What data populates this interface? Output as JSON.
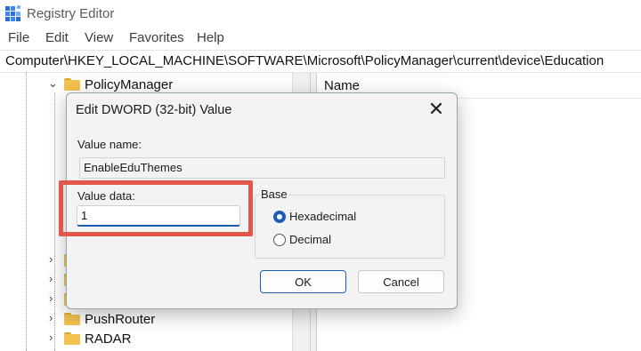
{
  "window": {
    "title": "Registry Editor"
  },
  "menu": {
    "items": [
      "File",
      "Edit",
      "View",
      "Favorites",
      "Help"
    ]
  },
  "address": {
    "path": "Computer\\HKEY_LOCAL_MACHINE\\SOFTWARE\\Microsoft\\PolicyManager\\current\\device\\Education"
  },
  "tree": {
    "expanded_item": "PolicyManager",
    "items": [
      "PushRouter",
      "RADAR"
    ]
  },
  "list": {
    "name_header": "Name"
  },
  "dialog": {
    "title": "Edit DWORD (32-bit) Value",
    "value_name_label": "Value name:",
    "value_name": "EnableEduThemes",
    "value_data_label": "Value data:",
    "value_data": "1",
    "base_label": "Base",
    "base_options": [
      "Hexadecimal",
      "Decimal"
    ],
    "base_selected": "Hexadecimal",
    "ok_label": "OK",
    "cancel_label": "Cancel",
    "close_glyph": "✕"
  },
  "colors": {
    "accent": "#1a5fb4",
    "highlight": "#e1574a",
    "folder": "#f3c24f"
  }
}
